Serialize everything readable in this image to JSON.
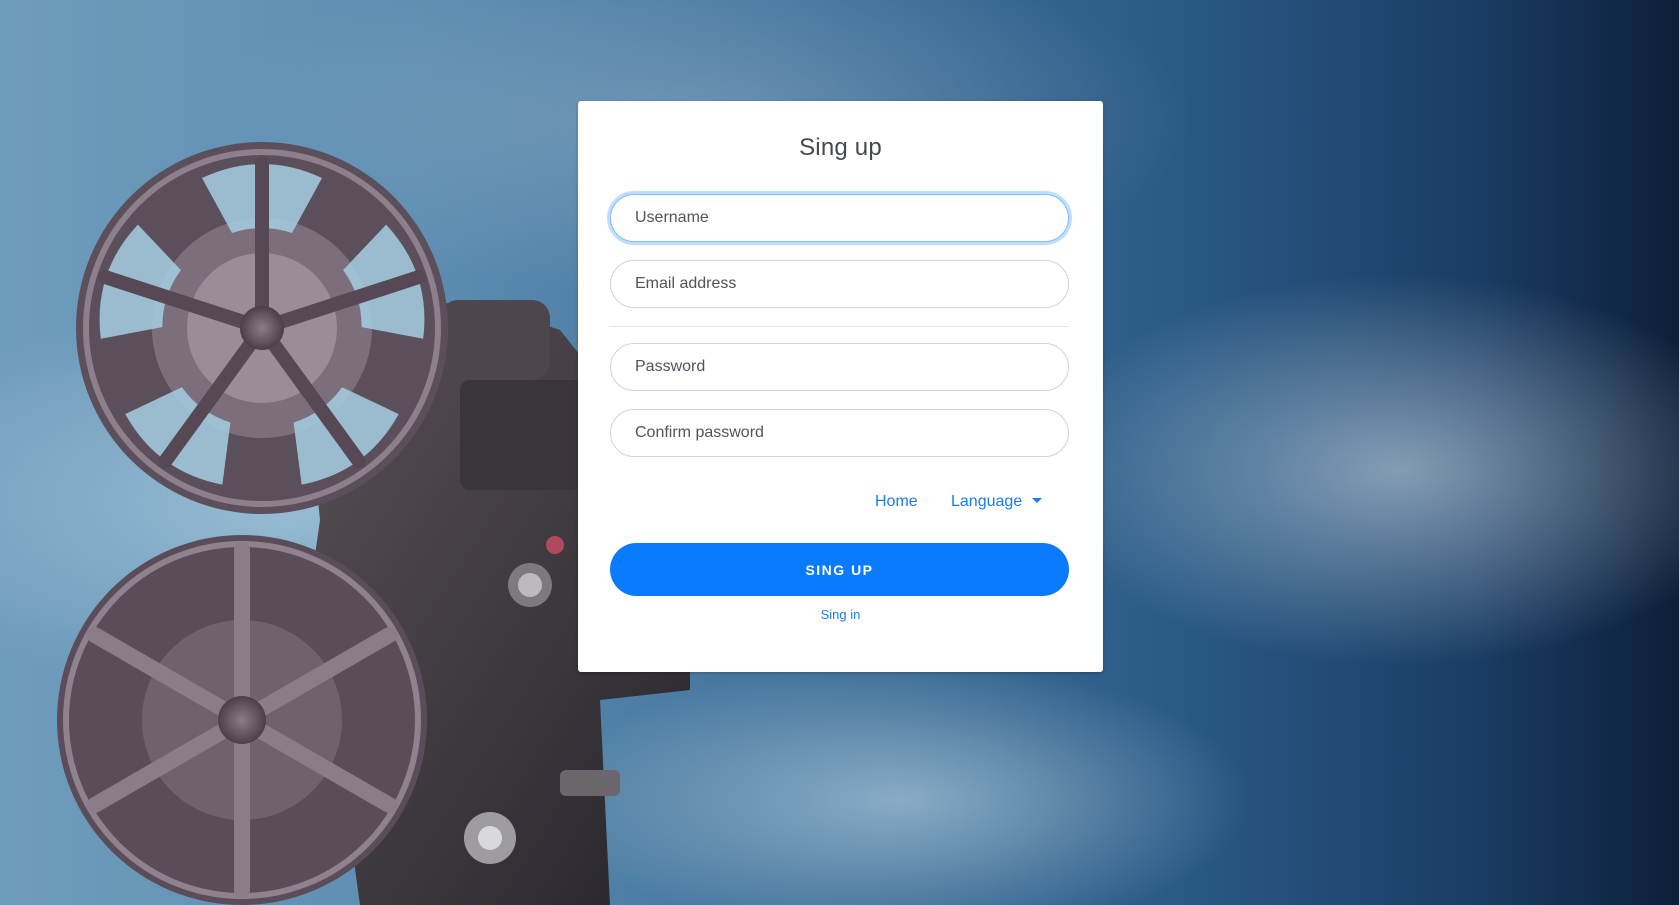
{
  "form": {
    "title": "Sing up",
    "username_placeholder": "Username",
    "email_placeholder": "Email address",
    "password_placeholder": "Password",
    "confirm_password_placeholder": "Confirm password",
    "home_link": "Home",
    "language_dropdown": "Language",
    "submit_button": "SING UP",
    "signin_link": "Sing in"
  },
  "colors": {
    "accent": "#0a7bff",
    "link": "#1a7cf0",
    "card": "#ffffff"
  },
  "background": {
    "image": "film-projector-with-reels-in-smoky-blue-haze"
  }
}
